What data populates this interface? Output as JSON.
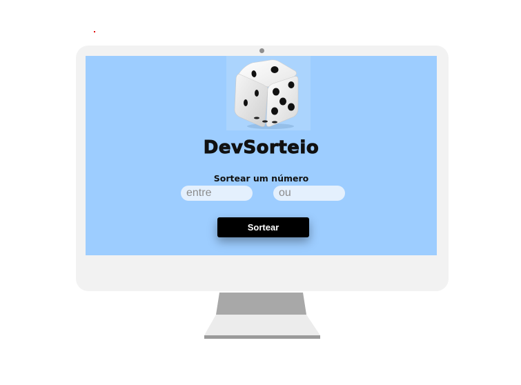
{
  "app": {
    "title": "DevSorteio",
    "subtitle": "Sortear um número"
  },
  "form": {
    "min_placeholder": "entre",
    "max_placeholder": "ou",
    "draw_button_label": "Sortear"
  },
  "icons": {
    "dice": "dice-icon"
  },
  "colors": {
    "screen_background": "#9dcdff",
    "monitor_frame": "#f2f2f2",
    "button_background": "#000000",
    "button_text": "#ffffff",
    "input_background": "#e4f0fd"
  }
}
